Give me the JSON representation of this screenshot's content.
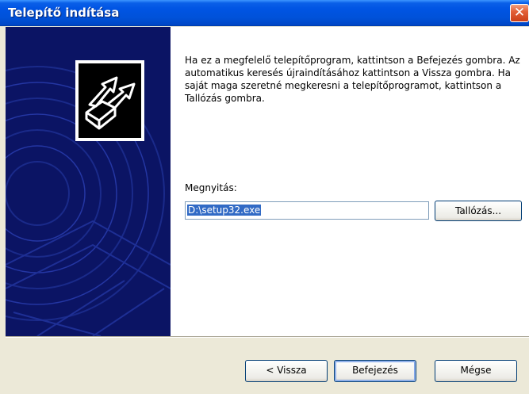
{
  "window": {
    "title": "Telepítő indítása",
    "close_symbol": "✕"
  },
  "description": "Ha ez a megfelelő telepítőprogram, kattintson a Befejezés gombra. Az automatikus keresés újraindításához kattintson a Vissza gombra. Ha saját maga szeretné megkeresni a telepítőprogramot, kattintson a Tallózás gombra.",
  "open_field": {
    "label": "Megnyitás:",
    "value": "D:\\setup32.exe"
  },
  "buttons": {
    "browse": "Tallózás...",
    "back": "< Vissza",
    "finish": "Befejezés",
    "cancel": "Mégse"
  },
  "icons": {
    "wizard": "setup-wizard-icon",
    "close": "close-icon"
  },
  "colors": {
    "titlebar": "#0054e3",
    "sidepanel": "#0b1464",
    "close": "#e36038",
    "selection": "#316ac5"
  }
}
